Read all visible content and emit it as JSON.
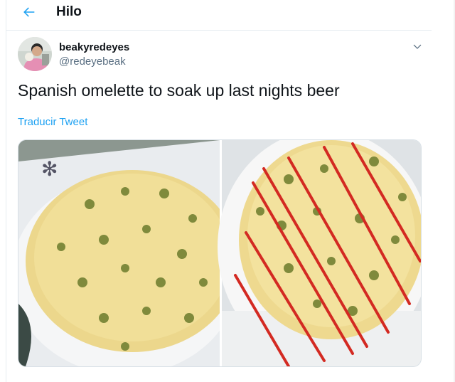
{
  "header": {
    "title": "Hilo"
  },
  "tweet": {
    "display_name": "beakyredeyes",
    "handle": "@redeyebeak",
    "text": "Spanish omelette to soak up last nights beer",
    "translate_label": "Traducir Tweet"
  },
  "icons": {
    "back": "arrow-left-icon",
    "more": "chevron-down-icon"
  },
  "colors": {
    "accent": "#1da1f2",
    "text_primary": "#0f1419",
    "text_secondary": "#5b7083",
    "divider": "#e6ecf0"
  }
}
